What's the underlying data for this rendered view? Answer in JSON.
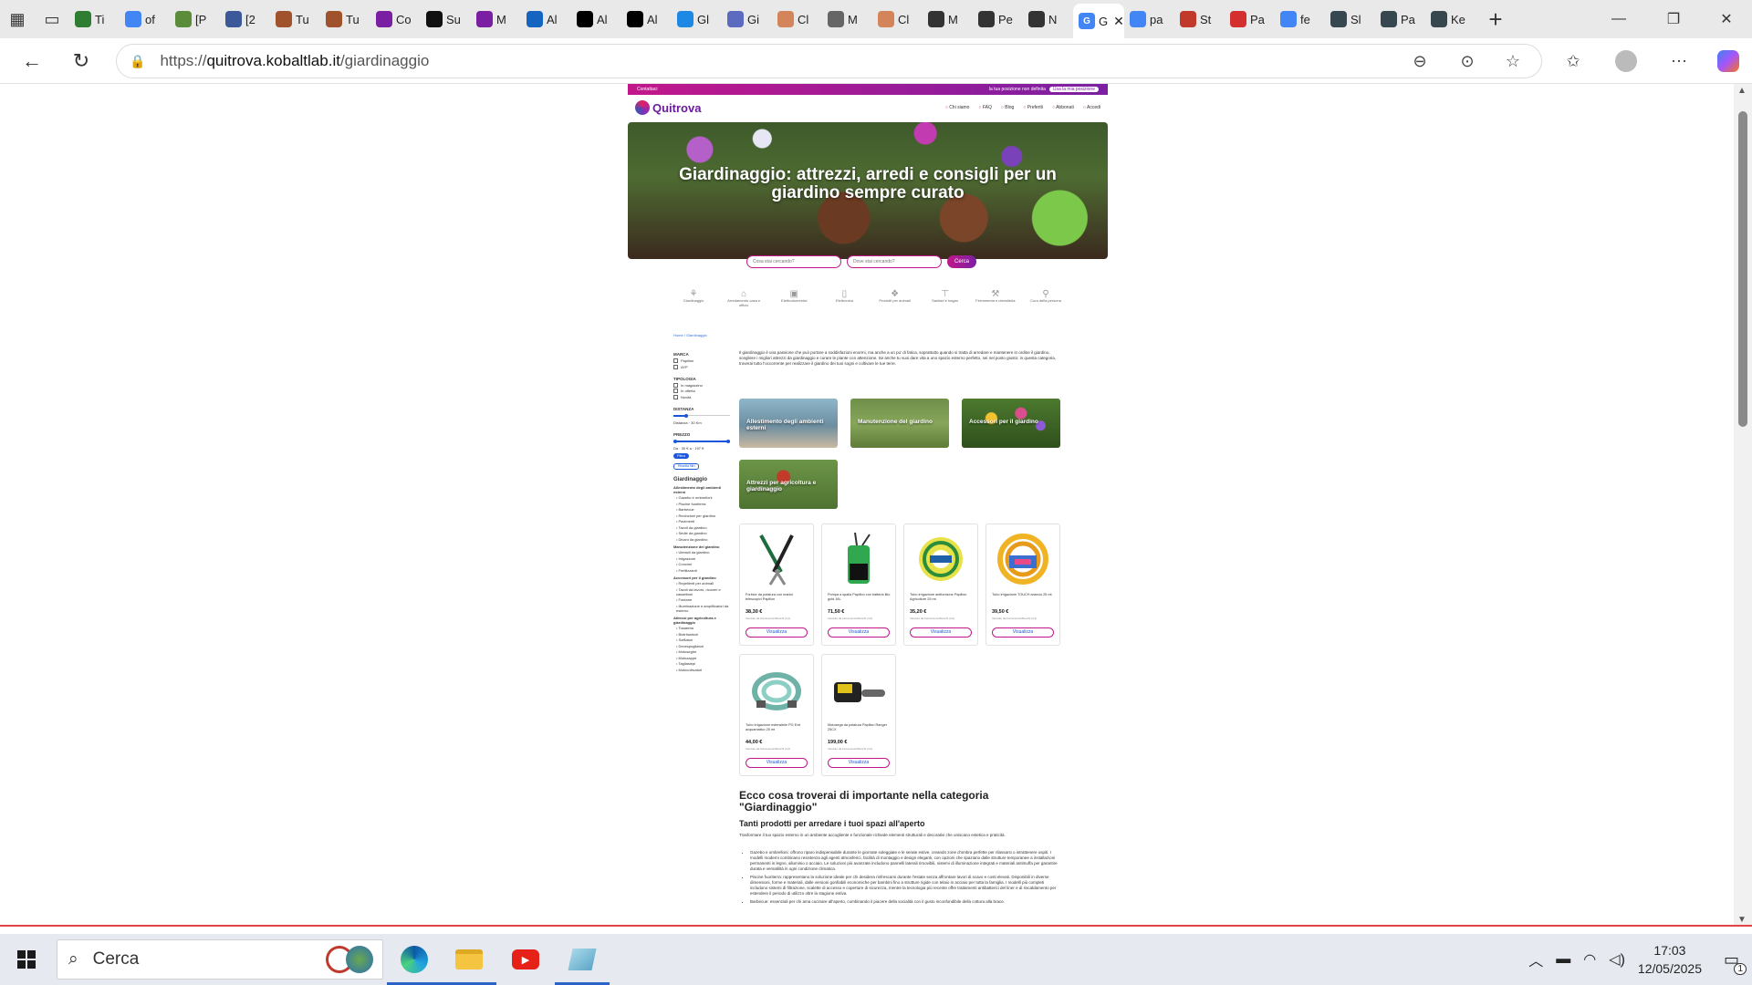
{
  "browser": {
    "tabs": [
      {
        "label": "Ti",
        "color": "#2e7d32"
      },
      {
        "label": "of",
        "color": "#4285f4"
      },
      {
        "label": "[P",
        "color": "#5b8c3a"
      },
      {
        "label": "[2",
        "color": "#3b5998"
      },
      {
        "label": "Tu",
        "color": "#a0522d"
      },
      {
        "label": "Tu",
        "color": "#a0522d"
      },
      {
        "label": "Co",
        "color": "#7b1fa2"
      },
      {
        "label": "Su",
        "color": "#111111"
      },
      {
        "label": "M",
        "color": "#7b1fa2"
      },
      {
        "label": "Al",
        "color": "#1565c0"
      },
      {
        "label": "Al",
        "color": "#000000"
      },
      {
        "label": "Al",
        "color": "#000000"
      },
      {
        "label": "Gl",
        "color": "#1e88e5"
      },
      {
        "label": "Gi",
        "color": "#5c6bc0"
      },
      {
        "label": "Cl",
        "color": "#d4845a"
      },
      {
        "label": "M",
        "color": "#666666"
      },
      {
        "label": "Cl",
        "color": "#d4845a"
      },
      {
        "label": "M",
        "color": "#333333"
      },
      {
        "label": "Pe",
        "color": "#333333"
      },
      {
        "label": "N",
        "color": "#333333"
      }
    ],
    "active_tab": {
      "label": "G",
      "close": "✕"
    },
    "tabs_after": [
      {
        "label": "pa",
        "color": "#4285f4"
      },
      {
        "label": "St",
        "color": "#c0392b"
      },
      {
        "label": "Pa",
        "color": "#d32f2f"
      },
      {
        "label": "fe",
        "color": "#4285f4"
      },
      {
        "label": "Sl",
        "color": "#37474f"
      },
      {
        "label": "Pa",
        "color": "#37474f"
      },
      {
        "label": "Ke",
        "color": "#37474f"
      }
    ],
    "new_tab": "+",
    "url_prefix": "https://",
    "url_host": "quitrova.kobaltlab.it",
    "url_path": "/giardinaggio"
  },
  "site": {
    "topstrip_left": "Contattaci",
    "topstrip_right": "la tua posizione non definita",
    "topstrip_pill": "Usa la mia posizione",
    "logo": "Quitrova",
    "nav": [
      "Chi siamo",
      "FAQ",
      "Blog",
      "Preferiti",
      "Abbonati",
      "Accedi"
    ],
    "hero_title": "Giardinaggio: attrezzi, arredi e consigli per un giardino sempre curato",
    "search_what_placeholder": "Cosa stai cercando?",
    "search_where_placeholder": "Dove stai cercando?",
    "search_button": "Cerca",
    "categories": [
      "Giardinaggio",
      "Arredamento casa e ufficio",
      "Elettrodomestici",
      "Elettronica",
      "Prodotti per animali",
      "Sanitari e bagno",
      "Ferramenta e utensileria",
      "Cura della persona"
    ],
    "breadcrumb": "Home / Giardinaggio",
    "sidebar": {
      "marca_title": "MARCA",
      "marca_options": [
        "Papillon",
        "AYP"
      ],
      "tipologia_title": "TIPOLOGIA",
      "tipologia_options": [
        "In magazzino",
        "In offerta",
        "Novità"
      ],
      "distanza_title": "DISTANZA",
      "distanza_value": "Distanza · 30 Km",
      "prezzo_title": "PREZZO",
      "prezzo_value": "Da · 30 € a · 197 €",
      "filter_button": "Filtra",
      "reset_button": "Resetta filtri",
      "section_title": "Giardinaggio",
      "groups": [
        {
          "title": "Allestimento degli ambienti esterni",
          "links": [
            "Gazebo e ombrelloni",
            "Piscine fuoriterra",
            "Barbecue",
            "Recinzioni per giardino",
            "Pavimenti",
            "Tavoli da giardino",
            "Sedie da giardino",
            "Divani da giardino"
          ]
        },
        {
          "title": "Manutenzione del giardino",
          "links": [
            "Utensili da giardino",
            "Irrigazione",
            "Concimi",
            "Fertilizzanti"
          ]
        },
        {
          "title": "Accessori per il giardino",
          "links": [
            "Repellenti per animali",
            "Tavoli da lavoro, ricoveri e cassettoni",
            "Fontane",
            "Illuminazione e amplificatori da esterno"
          ]
        },
        {
          "title": "Attrezzi per agricoltura e giardinaggio",
          "links": [
            "Tosaerba",
            "Biotrituratori",
            "Soffiatori",
            "Decespugliatori",
            "Motoseghe",
            "Motozappe",
            "Tagliasiepi",
            "Motocoltivatori"
          ]
        }
      ]
    },
    "intro": "Il giardinaggio è una passione che può portare a soddisfazioni enormi, ma anche a un po' di fatica, soprattutto quando si tratta di arredare e mantenere in ordine il giardino, scegliere i migliori attrezzi da giardinaggio e curare le piante con attenzione. Se anche tu vuoi dare vita a uno spazio esterno perfetto, sei nel posto giusto: in questa categoria, troverai tutto l'occorrente per realizzare il giardino dei tuoi sogni e coltivare le tue terre.",
    "subcategories": [
      "Allestimento degli ambienti esterni",
      "Manutenzione del giardino",
      "Accessori per il giardino",
      "Attrezzi per agricoltura e giardinaggio"
    ],
    "products": [
      {
        "name": "Forbice da potatura con manici telescopici Papillon",
        "price": "38,30 €",
        "note": "Venduto da Ferramenta Bianchi (4,2)",
        "button": "Visualizza"
      },
      {
        "name": "Pompa a spalla Papillon con batteria litio gold 16L",
        "price": "71,50 €",
        "note": "Venduto da Ferramenta Bianchi (4,2)",
        "button": "Visualizza"
      },
      {
        "name": "Tubo irrigazione antitorsione Papillon Agricolture 25 mt",
        "price": "35,20 €",
        "note": "Venduto da Ferramenta Bianchi (4,2)",
        "button": "Visualizza"
      },
      {
        "name": "Tubo irrigazione TOUCH arancio 25 mt",
        "price": "39,50 €",
        "note": "Venduto da Ferramenta Bianchi (4,2)",
        "button": "Visualizza"
      },
      {
        "name": "Tubo irrigazione estensibile PG Exit acquamatico 25 mt",
        "price": "44,00 €",
        "note": "Venduto da Ferramenta Bianchi (4,2)",
        "button": "Visualizza"
      },
      {
        "name": "Motosega da potatura Papillon Ranger 25CX",
        "price": "199,00 €",
        "note": "Venduto da Ferramenta Bianchi (4,2)",
        "button": "Visualizza"
      }
    ],
    "important_title": "Ecco cosa troverai di importante nella categoria \"Giardinaggio\"",
    "important_subtitle": "Tanti prodotti per arredare i tuoi spazi all'aperto",
    "important_paragraph": "Trasformare il tuo spazio esterno in un ambiente accogliente e funzionale richiede elementi strutturali e decorativi che uniscano estetica e praticità.",
    "bullets": [
      "Gazebo e ombrelloni: offrono riparo indispensabile durante le giornate soleggiate e le serate estive, creando zone d'ombra perfette per rilassarsi o intrattenere ospiti. I modelli moderni combinano resistenza agli agenti atmosferici, facilità di montaggio e design eleganti, con opzioni che spaziano dalle strutture temporanee a installazioni permanenti in legno, alluminio o acciaio. Le soluzioni più avanzate includono pannelli laterali rimovibili, sistemi di illuminazione integrati e materiali antimuffa per garantire durata e versatilità in ogni condizione climatica.",
      "Piscine fuoriterra: rappresentano la soluzione ideale per chi desidera rinfrescarsi durante l'estate senza affrontare lavori di scavo e costi elevati. Disponibili in diverse dimensioni, forme e materiali, dalle versioni gonfiabili economiche per bambini fino a strutture rigide con telaio in acciaio per tutta la famiglia. I modelli più completi includono sistemi di filtrazione, scalette di accesso e coperture di sicurezza, mentre la tecnologia più recente offre trattamenti antibatterici del liner e di riscaldamento per estendere il periodo di utilizzo oltre la stagione estiva.",
      "Barbecue: essenziali per chi ama cucinare all'aperto, combinando il piacere della socialità con il gusto inconfondibile della cottura alla brace."
    ]
  },
  "taskbar": {
    "search_label": "Cerca",
    "time": "17:03",
    "date": "12/05/2025",
    "notifications": "1"
  }
}
